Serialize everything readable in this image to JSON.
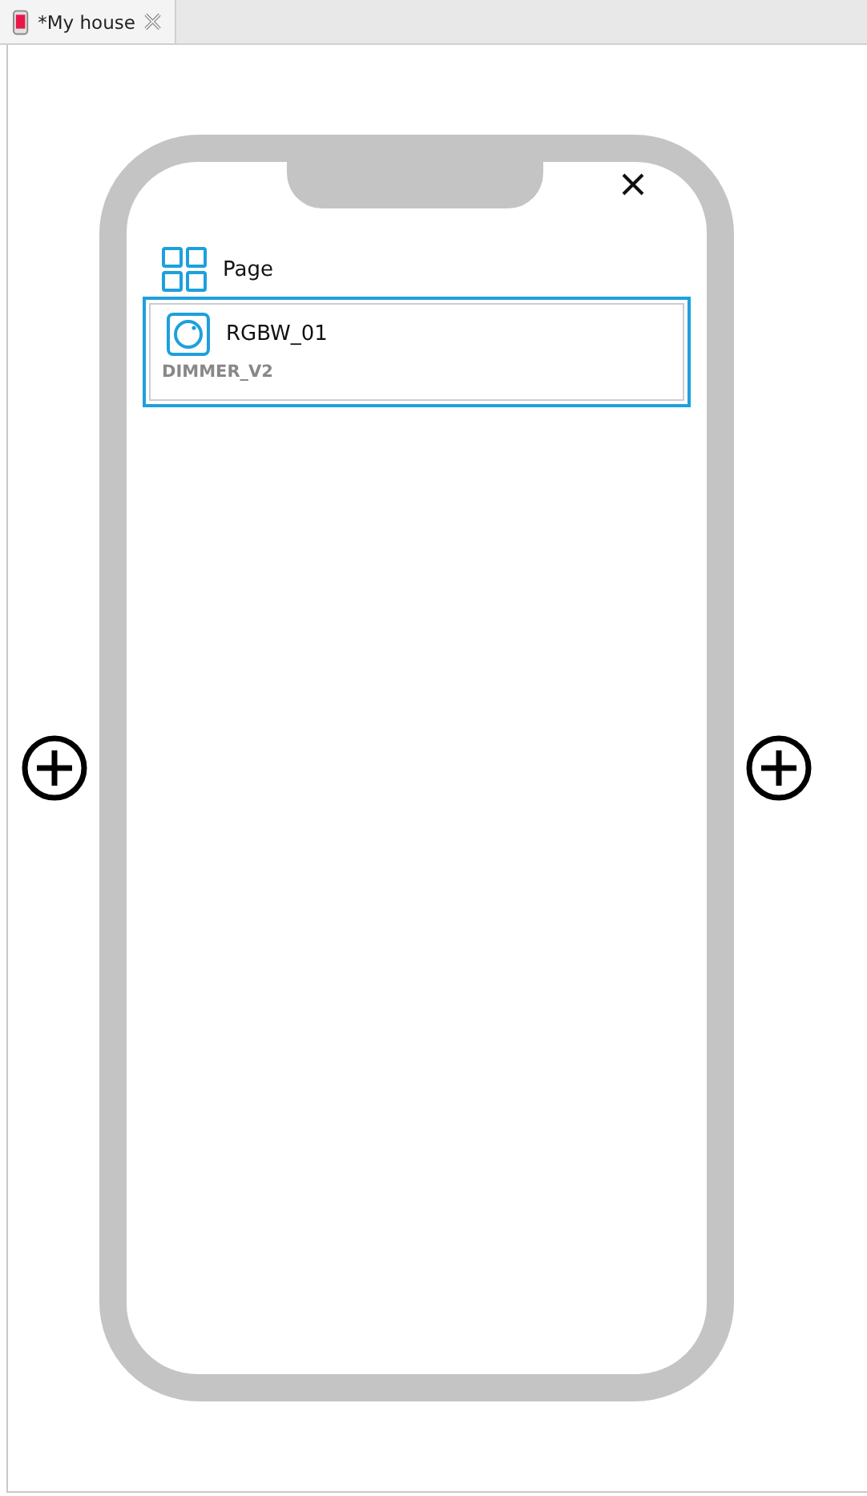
{
  "tab": {
    "title": "*My house",
    "selected": true
  },
  "page": {
    "label": "Page"
  },
  "widgets": [
    {
      "name": "RGBW_01",
      "type": "DIMMER_V2",
      "selected": true
    }
  ]
}
